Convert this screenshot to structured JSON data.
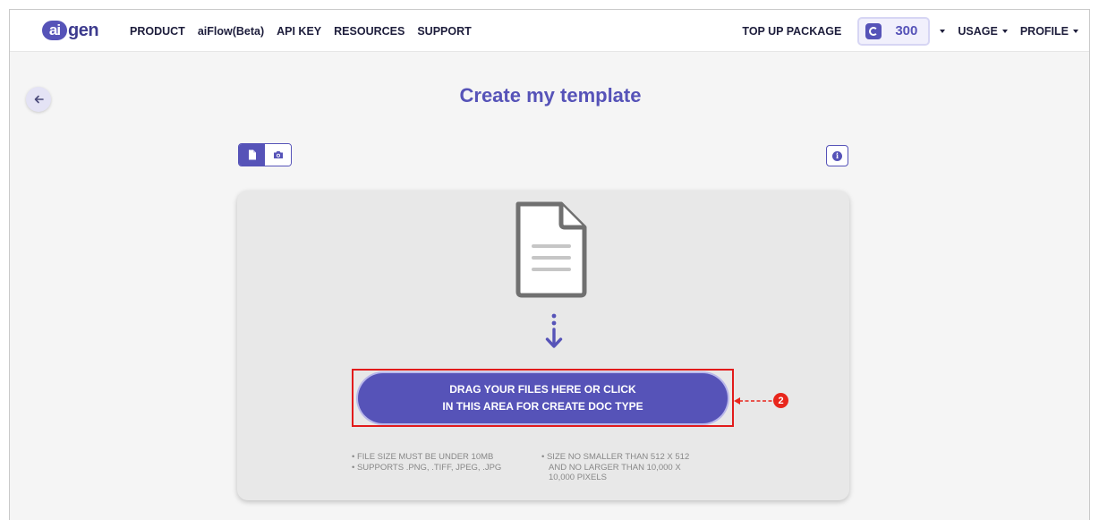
{
  "header": {
    "logo_badge": "ai",
    "logo_rest": "gen",
    "nav": [
      "PRODUCT",
      "aiFlow(Beta)",
      "API KEY",
      "RESOURCES",
      "SUPPORT"
    ],
    "top_up": "TOP UP PACKAGE",
    "credits": "300",
    "usage": "USAGE",
    "profile": "PROFILE"
  },
  "page": {
    "title": "Create my template",
    "back_icon": "arrow-left-icon",
    "mode_icons": [
      "file-icon",
      "camera-icon"
    ],
    "active_mode": "file",
    "info_icon": "info-icon",
    "info_glyph": "i"
  },
  "dropzone": {
    "line1": "DRAG YOUR FILES HERE OR CLICK",
    "line2": "IN THIS AREA FOR CREATE DOC TYPE",
    "annotation": "2",
    "notes_left": [
      "FILE SIZE MUST BE UNDER 10MB",
      "SUPPORTS .PNG, .TIFF, JPEG, .JPG"
    ],
    "notes_right": [
      "SIZE NO SMALLER THAN 512 X 512",
      "AND NO LARGER THAN 10,000 X",
      "10,000 PIXELS"
    ]
  },
  "colors": {
    "accent": "#5653b8",
    "highlight_border": "#e21b1b",
    "annotation_badge": "#e8261c"
  }
}
